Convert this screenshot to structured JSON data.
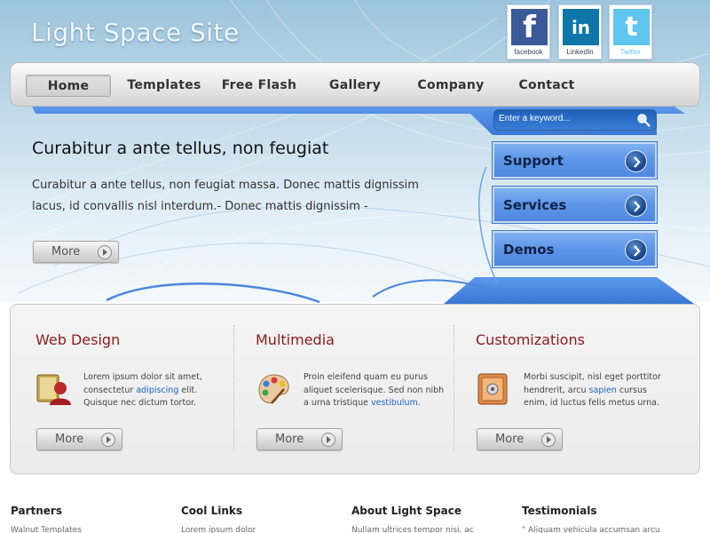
{
  "header": {
    "site_title": "Light Space Site"
  },
  "social": [
    {
      "name": "facebook",
      "glyph": "f",
      "caption": "facebook",
      "color": "#3b5998"
    },
    {
      "name": "linkedin",
      "glyph": "in",
      "caption": "LinkedIn",
      "color": "#0e76a8"
    },
    {
      "name": "twitter",
      "glyph": "t",
      "caption": "Twitter",
      "color": "#5ec6ef"
    }
  ],
  "nav": {
    "items": [
      "Home",
      "Templates",
      "Free Flash",
      "Gallery",
      "Company",
      "Contact"
    ],
    "active": "Home"
  },
  "search": {
    "placeholder": "Enter a keyword..."
  },
  "side_buttons": [
    "Support",
    "Services",
    "Demos"
  ],
  "hero": {
    "title": "Curabitur a ante tellus, non feugiat",
    "text": "Curabitur a ante tellus, non feugiat massa. Donec mattis dignissim lacus, id convallis nisl interdum.- Donec mattis dignissim -",
    "more_label": "More"
  },
  "columns": [
    {
      "title": "Web Design",
      "text_before": "Lorem ipsum dolor sit amet, consectetur ",
      "link": "adipiscing",
      "text_after": " elit. Quisque nec dictum tortor.",
      "icon": "user-book-icon",
      "more_label": "More"
    },
    {
      "title": "Multimedia",
      "text_before": "Proin eleifend quam eu purus aliquet scelerisque. Sed non nibh a urna tristique ",
      "link": "vestibulum",
      "text_after": ".",
      "icon": "palette-icon",
      "more_label": "More"
    },
    {
      "title": "Customizations",
      "text_before": "Morbi suscipit, nisl eget porttitor hendrerit, arcu ",
      "link": "sapien",
      "text_after": " cursus enim, id luctus felis metus urna.",
      "icon": "safe-icon",
      "more_label": "More"
    }
  ],
  "footer": [
    {
      "heading": "Partners",
      "text": "Walnut Templates"
    },
    {
      "heading": "Cool Links",
      "text": "Lorem ipsum dolor"
    },
    {
      "heading": "About Light Space",
      "text": "Nullam ultrices tempor nisi, ac"
    },
    {
      "heading": "Testimonials",
      "text": "\" Aliquam vehicula accumsan arcu"
    }
  ],
  "colors": {
    "accent_blue": "#4f88df",
    "title_red": "#8e1a1a",
    "link_blue": "#1a66c4"
  }
}
